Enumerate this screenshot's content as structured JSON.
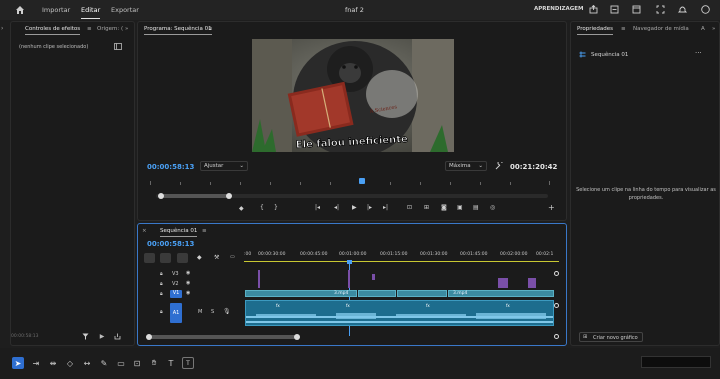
{
  "topbar": {
    "home_icon": "home-icon",
    "menu": [
      "Importar",
      "Editar",
      "Exportar"
    ],
    "title": "fnaf 2",
    "learn": "APRENDIZAGEM"
  },
  "left_panel": {
    "tabs": [
      "Controles de efeitos",
      "Origem: ("
    ],
    "no_clip": "(nenhum clipe selecionado)",
    "timecode": "00:00:58:13"
  },
  "program": {
    "title": "Programa: Sequência 01",
    "caption": "Ele falou ineficiente",
    "book_text": "A Sciences",
    "timecode_left": "00:00:58:13",
    "fit_label": "Ajustar",
    "quality_label": "Máxima",
    "timecode_right": "00:21:20:42"
  },
  "timeline": {
    "tab": "Sequência 01",
    "timecode": "00:00:58:13",
    "ruler": [
      ":00",
      "00:00:30:00",
      "00:00:45:00",
      "00:01:00:00",
      "00:01:15:00",
      "00:01:30:00",
      "00:01:45:00",
      "00:02:00:00",
      "00:02:1"
    ],
    "tracks": [
      "V3",
      "V2",
      "V1",
      "A1"
    ],
    "track_a1_labels": [
      "M",
      "S"
    ],
    "clips": [
      "3.mp4",
      "3.mp4"
    ],
    "fx": "fx"
  },
  "right_panel": {
    "tabs": [
      "Propriedades",
      "Navegador de mídia",
      "A"
    ],
    "sequence": "Sequência 01",
    "hint": "Selecione um clipe na linha do tempo para visualizar as propriedades.",
    "new_graphic": "Criar novo gráfico"
  },
  "colors": {
    "accent_blue": "#4aa0f5",
    "clip_video": "#3b8aa0",
    "clip_audio": "#1d6d8e",
    "playhead": "#4aa0f5"
  }
}
